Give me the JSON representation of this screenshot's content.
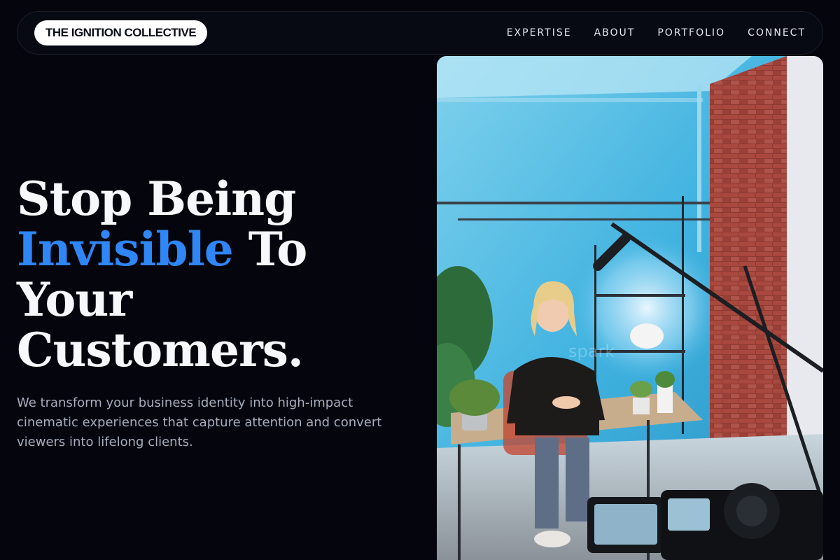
{
  "header": {
    "logo_text": "THE IGNITION COLLECTIVE",
    "nav": [
      {
        "label": "EXPERTISE"
      },
      {
        "label": "ABOUT"
      },
      {
        "label": "PORTFOLIO"
      },
      {
        "label": "CONNECT"
      }
    ]
  },
  "hero": {
    "headline_part1": "Stop Being",
    "headline_accent": "Invisible",
    "headline_part2": " To Your Customers.",
    "subtext": "We transform your business identity into high-impact cinematic experiences that capture attention and convert viewers into lifelong clients.",
    "image_alt": "Smiling woman seated at a desk in a studio with microphone boom and camera in the foreground",
    "watermark": "spark"
  },
  "colors": {
    "background": "#05060d",
    "accent": "#2f86f6",
    "text": "#f7f8fb",
    "muted": "#a7adbd"
  }
}
